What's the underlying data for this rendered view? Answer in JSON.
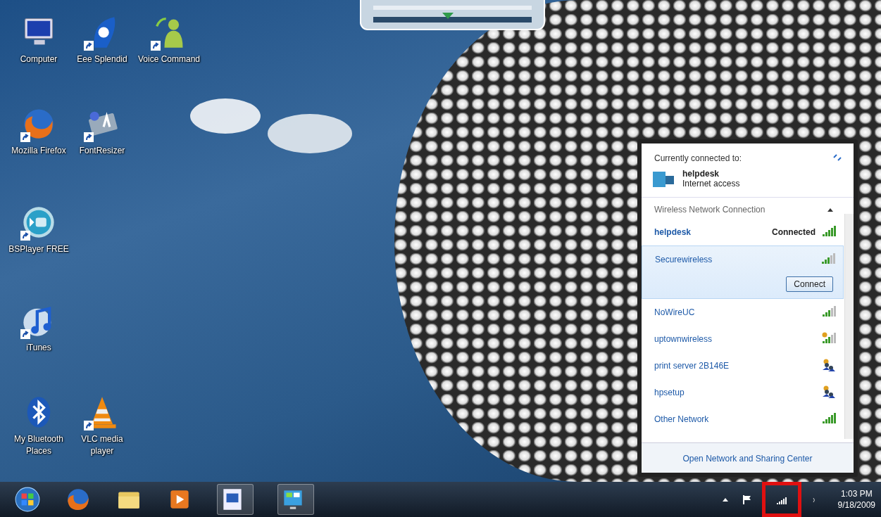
{
  "desktop_icons": [
    {
      "label": "Computer",
      "kind": "computer",
      "shortcut": false
    },
    {
      "label": "Eee Splendid",
      "kind": "splendid",
      "shortcut": true
    },
    {
      "label": "Voice Command",
      "kind": "voice",
      "shortcut": true
    },
    {
      "label": "Mozilla Firefox",
      "kind": "firefox",
      "shortcut": true
    },
    {
      "label": "FontResizer",
      "kind": "fontresizer",
      "shortcut": true
    },
    {
      "label": "BSPlayer FREE",
      "kind": "bsplayer",
      "shortcut": true
    },
    {
      "label": "iTunes",
      "kind": "itunes",
      "shortcut": true
    },
    {
      "label": "My Bluetooth Places",
      "kind": "bluetooth",
      "shortcut": false
    },
    {
      "label": "VLC media player",
      "kind": "vlc",
      "shortcut": true
    }
  ],
  "network_popup": {
    "header": "Currently connected to:",
    "current": {
      "name": "helpdesk",
      "status": "Internet access"
    },
    "section": {
      "title": "Wireless Network Connection",
      "expanded": true
    },
    "networks": [
      {
        "name": "helpdesk",
        "status": "Connected",
        "connected": true,
        "selected": false,
        "kind": "full"
      },
      {
        "name": "Securewireless",
        "connected": false,
        "selected": true,
        "kind": "partial",
        "button": "Connect"
      },
      {
        "name": "NoWireUC",
        "connected": false,
        "selected": false,
        "kind": "partial"
      },
      {
        "name": "uptownwireless",
        "connected": false,
        "selected": false,
        "kind": "warning"
      },
      {
        "name": "print server 2B146E",
        "connected": false,
        "selected": false,
        "kind": "adhoc"
      },
      {
        "name": "hpsetup",
        "connected": false,
        "selected": false,
        "kind": "adhoc"
      },
      {
        "name": "Other Network",
        "connected": false,
        "selected": false,
        "kind": "full"
      }
    ],
    "footer_link": "Open Network and Sharing Center"
  },
  "taskbar": {
    "items": [
      {
        "kind": "start"
      },
      {
        "kind": "firefox"
      },
      {
        "kind": "folder"
      },
      {
        "kind": "media"
      },
      {
        "kind": "word"
      },
      {
        "kind": "network-app"
      }
    ],
    "tray": [
      {
        "kind": "arrow",
        "highlighted": false
      },
      {
        "kind": "flag",
        "highlighted": false
      },
      {
        "kind": "network",
        "highlighted": true
      },
      {
        "kind": "volume",
        "highlighted": false
      }
    ],
    "clock": {
      "time": "1:03 PM",
      "date": "9/18/2009"
    }
  }
}
